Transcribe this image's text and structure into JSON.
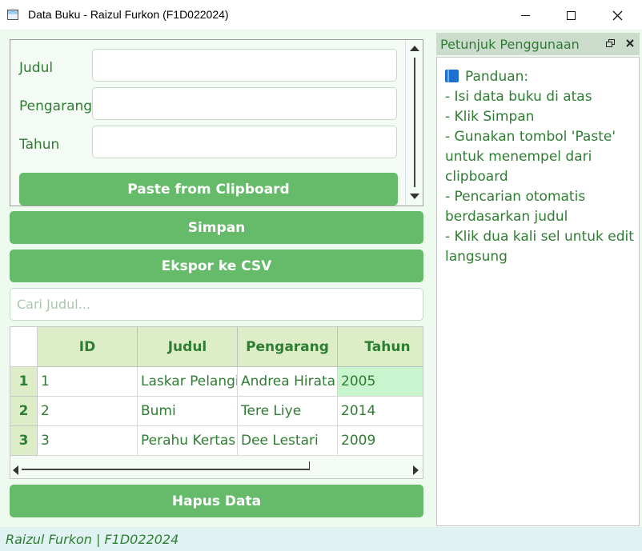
{
  "window": {
    "title": "Data Buku - Raizul Furkon (F1D022024)"
  },
  "form": {
    "labels": {
      "judul": "Judul",
      "pengarang": "Pengarang",
      "tahun": "Tahun"
    },
    "values": {
      "judul": "",
      "pengarang": "",
      "tahun": ""
    },
    "paste_button": "Paste from Clipboard"
  },
  "buttons": {
    "simpan": "Simpan",
    "ekspor": "Ekspor ke CSV",
    "hapus": "Hapus Data"
  },
  "search": {
    "placeholder": "Cari Judul...",
    "value": ""
  },
  "table": {
    "columns": [
      "ID",
      "Judul",
      "Pengarang",
      "Tahun"
    ],
    "rows": [
      {
        "row": "1",
        "cells": [
          "1",
          "Laskar Pelangi",
          "Andrea Hirata",
          "2005"
        ]
      },
      {
        "row": "2",
        "cells": [
          "2",
          "Bumi",
          "Tere Liye",
          "2014"
        ]
      },
      {
        "row": "3",
        "cells": [
          "3",
          "Perahu Kertas",
          "Dee Lestari",
          "2009"
        ]
      }
    ],
    "selected_cell": {
      "row": 1,
      "column": "Tahun"
    }
  },
  "dock": {
    "title": "Petunjuk Penggunaan",
    "lines": [
      "Panduan:",
      "- Isi data buku di atas",
      "- Klik Simpan",
      "- Gunakan tombol 'Paste'",
      "untuk menempel dari",
      "clipboard",
      "- Pencarian otomatis",
      "berdasarkan judul",
      "- Klik dua kali sel untuk edit",
      "langsung"
    ],
    "icon": "book-icon"
  },
  "statusbar": {
    "text": "Raizul Furkon | F1D022024"
  },
  "colors": {
    "accent": "#66bb6a",
    "text": "#2e7d32",
    "header": "#dcedc8",
    "background": "#eefaf0",
    "selected": "#c8f5cd"
  }
}
